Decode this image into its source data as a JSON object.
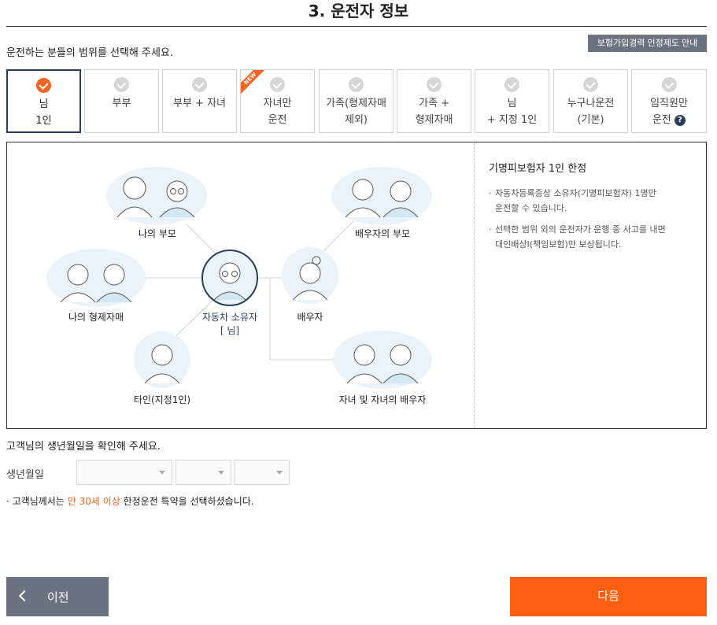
{
  "header": {
    "title": "3. 운전자 정보"
  },
  "section1": {
    "question": "운전하는 분들의 범위를 선택해 주세요.",
    "guide_button": "보험가입경력 인정제도 안내"
  },
  "options": [
    {
      "label": "님\n1인",
      "selected": true
    },
    {
      "label": "부부",
      "selected": false
    },
    {
      "label": "부부 + 자녀",
      "selected": false
    },
    {
      "label": "자녀만\n운전",
      "selected": false,
      "badge": "NEW"
    },
    {
      "label": "가족(형제자매\n제외)",
      "selected": false
    },
    {
      "label": "가족 +\n형제자매",
      "selected": false
    },
    {
      "label": "님\n+ 지정 1인",
      "selected": false
    },
    {
      "label": "누구나운전\n(기본)",
      "selected": false
    },
    {
      "label": "임직원만\n운전",
      "selected": false
    }
  ],
  "diagram": {
    "parents": "나의 부모",
    "spouse_parents": "배우자의 부모",
    "siblings": "나의 형제자매",
    "owner": "자동차 소유자",
    "owner_name": "[            님]",
    "spouse": "배우자",
    "designated": "타인(지정1인)",
    "children": "자녀 및 자녀의 배우자"
  },
  "info": {
    "title": "기명피보험자 1인 한정",
    "items": [
      "자동차등록증상 소유자(기명피보험자) 1명만\n운전할 수 있습니다.",
      "선택한 범위 외의 운전자가 운행 중 사고를 내면\n대인배상I(책임보험)만 보상됩니다."
    ]
  },
  "section2": {
    "question": "고객님의 생년월일을 확인해 주세요.",
    "birth_label": "생년월일",
    "notice_pre": "고객님께서는 ",
    "notice_highlight": "만 30세 이상",
    "notice_post": " 한정운전 특약을 선택하셨습니다."
  },
  "footer": {
    "prev": "이전",
    "next": "다음"
  },
  "colors": {
    "accent": "#ff5f0f",
    "navy": "#2a3f5c",
    "gray_button": "#6b7280"
  }
}
